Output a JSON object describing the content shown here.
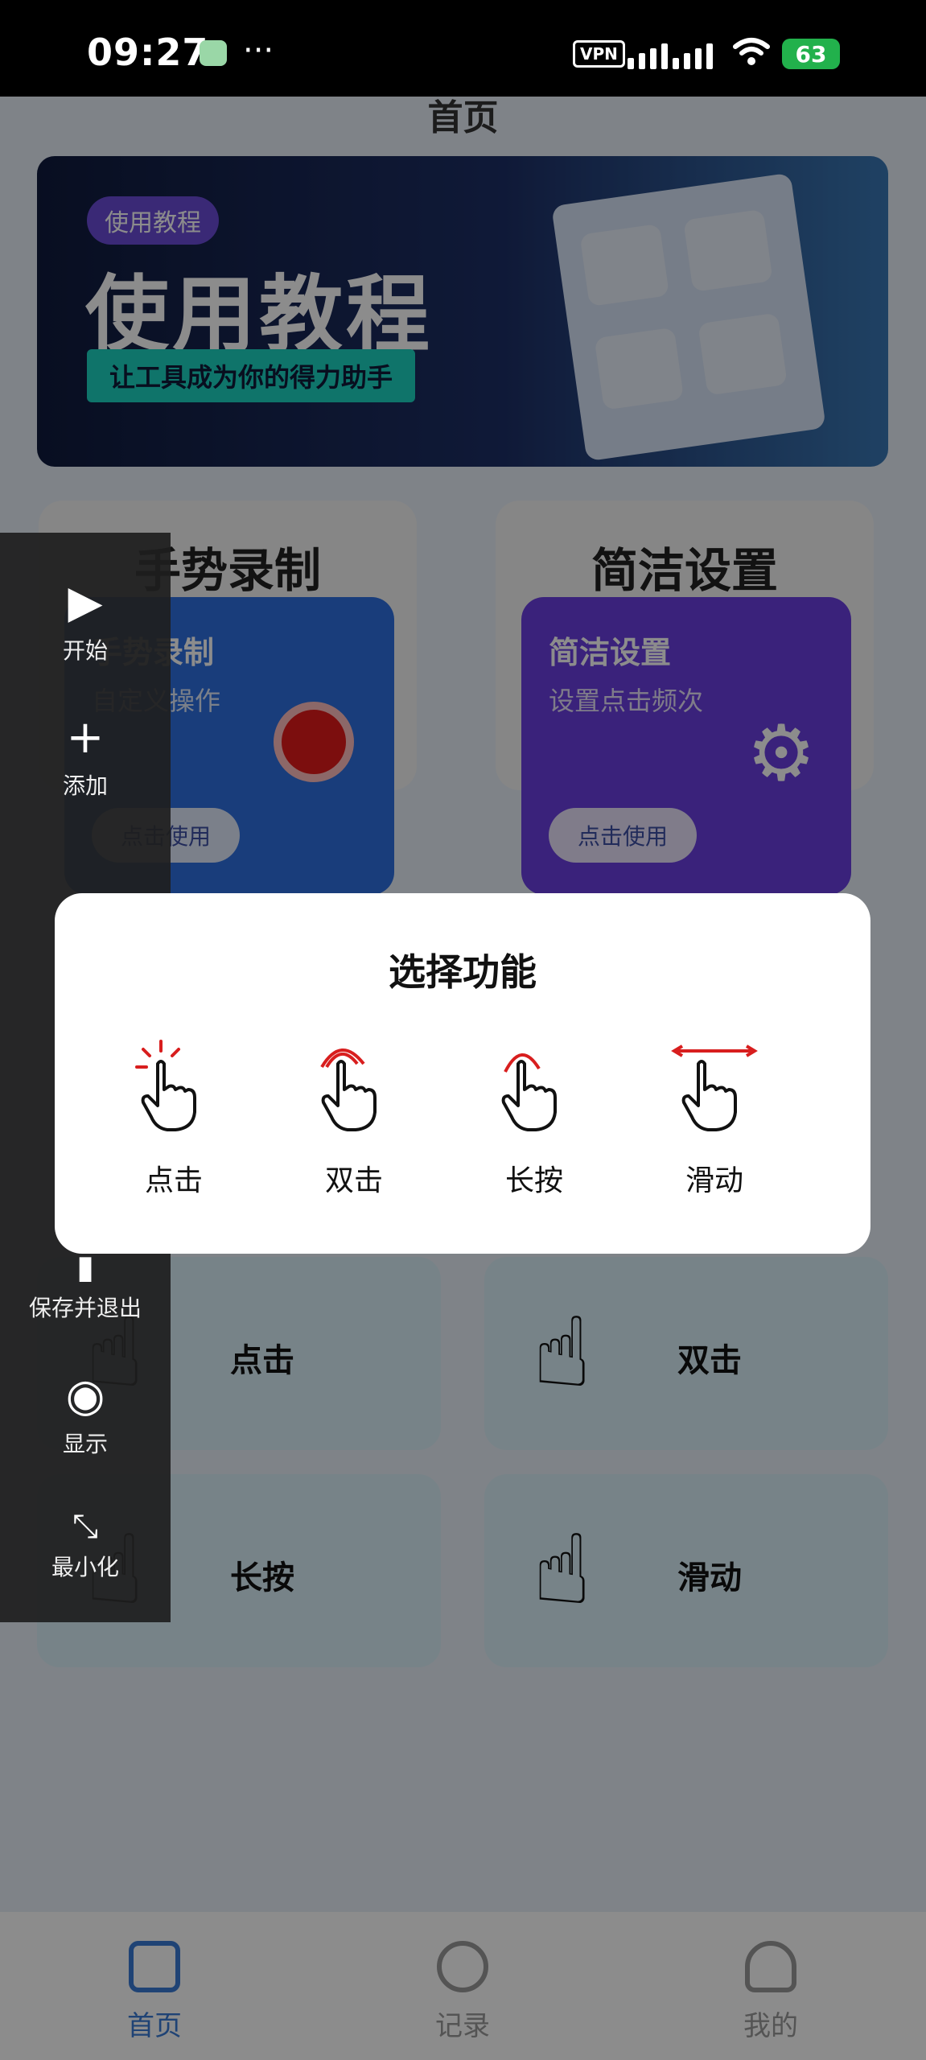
{
  "status": {
    "time": "09:27",
    "vpn": "VPN",
    "battery": "63"
  },
  "page": {
    "title": "首页",
    "banner": {
      "tag": "使用教程",
      "title": "使用教程",
      "subtitle": "让工具成为你的得力助手"
    },
    "cards": [
      {
        "heading": "手势录制",
        "title": "手势录制",
        "desc": "自定义操作",
        "button": "点击使用"
      },
      {
        "heading": "简洁设置",
        "title": "简洁设置",
        "desc": "设置点击频次",
        "button": "点击使用"
      }
    ],
    "grid": [
      {
        "label": "点击"
      },
      {
        "label": "双击"
      },
      {
        "label": "长按"
      },
      {
        "label": "滑动"
      }
    ]
  },
  "floatbar": {
    "items": [
      {
        "icon": "play-icon",
        "label": "开始"
      },
      {
        "icon": "plus-icon",
        "label": "添加"
      },
      {
        "icon": "save-icon",
        "label": "保存并退出"
      },
      {
        "icon": "eye-icon",
        "label": "显示"
      },
      {
        "icon": "minimize-icon",
        "label": "最小化"
      }
    ]
  },
  "modal": {
    "title": "选择功能",
    "options": [
      {
        "icon": "tap-icon",
        "label": "点击"
      },
      {
        "icon": "double-tap-icon",
        "label": "双击"
      },
      {
        "icon": "long-press-icon",
        "label": "长按"
      },
      {
        "icon": "swipe-icon",
        "label": "滑动"
      }
    ]
  },
  "nav": {
    "items": [
      {
        "icon": "home-icon",
        "label": "首页",
        "active": true
      },
      {
        "icon": "history-icon",
        "label": "记录",
        "active": false
      },
      {
        "icon": "profile-icon",
        "label": "我的",
        "active": false
      }
    ]
  },
  "colors": {
    "accent": "#3a7bd5",
    "recordCard": "#2f6fe0",
    "settingsCard": "#6a3fe0",
    "gestureRed": "#d81e1e"
  }
}
